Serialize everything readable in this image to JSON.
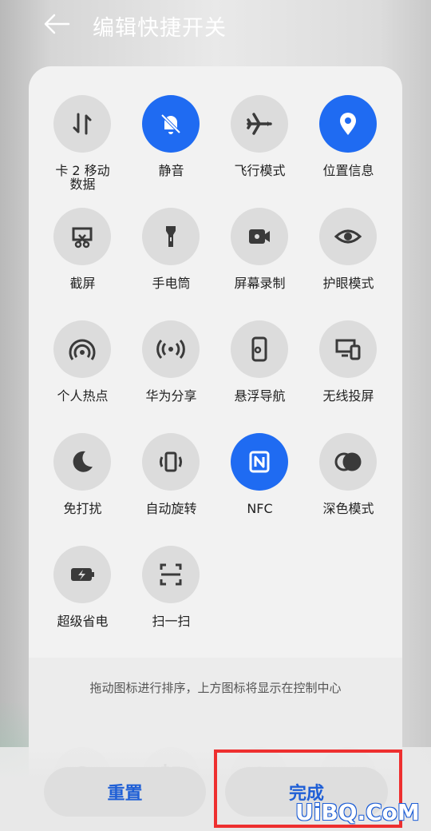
{
  "header": {
    "title": "编辑快捷开关"
  },
  "tiles": [
    {
      "label": "卡 2 移动\n数据",
      "active": false,
      "icon": "mobile-data-icon"
    },
    {
      "label": "静音",
      "active": true,
      "icon": "bell-off-icon"
    },
    {
      "label": "飞行模式",
      "active": false,
      "icon": "airplane-icon"
    },
    {
      "label": "位置信息",
      "active": true,
      "icon": "location-pin-icon"
    },
    {
      "label": "截屏",
      "active": false,
      "icon": "screenshot-icon"
    },
    {
      "label": "手电筒",
      "active": false,
      "icon": "flashlight-icon"
    },
    {
      "label": "屏幕录制",
      "active": false,
      "icon": "screen-record-icon"
    },
    {
      "label": "护眼模式",
      "active": false,
      "icon": "eye-icon"
    },
    {
      "label": "个人热点",
      "active": false,
      "icon": "hotspot-icon"
    },
    {
      "label": "华为分享",
      "active": false,
      "icon": "huawei-share-icon"
    },
    {
      "label": "悬浮导航",
      "active": false,
      "icon": "floating-navigation-icon"
    },
    {
      "label": "无线投屏",
      "active": false,
      "icon": "wireless-projection-icon"
    },
    {
      "label": "免打扰",
      "active": false,
      "icon": "moon-icon"
    },
    {
      "label": "自动旋转",
      "active": false,
      "icon": "auto-rotate-icon"
    },
    {
      "label": "NFC",
      "active": true,
      "icon": "nfc-icon"
    },
    {
      "label": "深色模式",
      "active": false,
      "icon": "dark-mode-icon"
    },
    {
      "label": "超级省电",
      "active": false,
      "icon": "battery-saver-icon"
    },
    {
      "label": "扫一扫",
      "active": false,
      "icon": "scan-icon"
    }
  ],
  "hint": "拖动图标进行排序，上方图标将显示在控制中心",
  "buttons": {
    "reset": "重置",
    "done": "完成"
  },
  "watermark": "UiBQ.CoM",
  "colors": {
    "accent": "#1f6bf2",
    "highlight": "#ee2f2f"
  }
}
